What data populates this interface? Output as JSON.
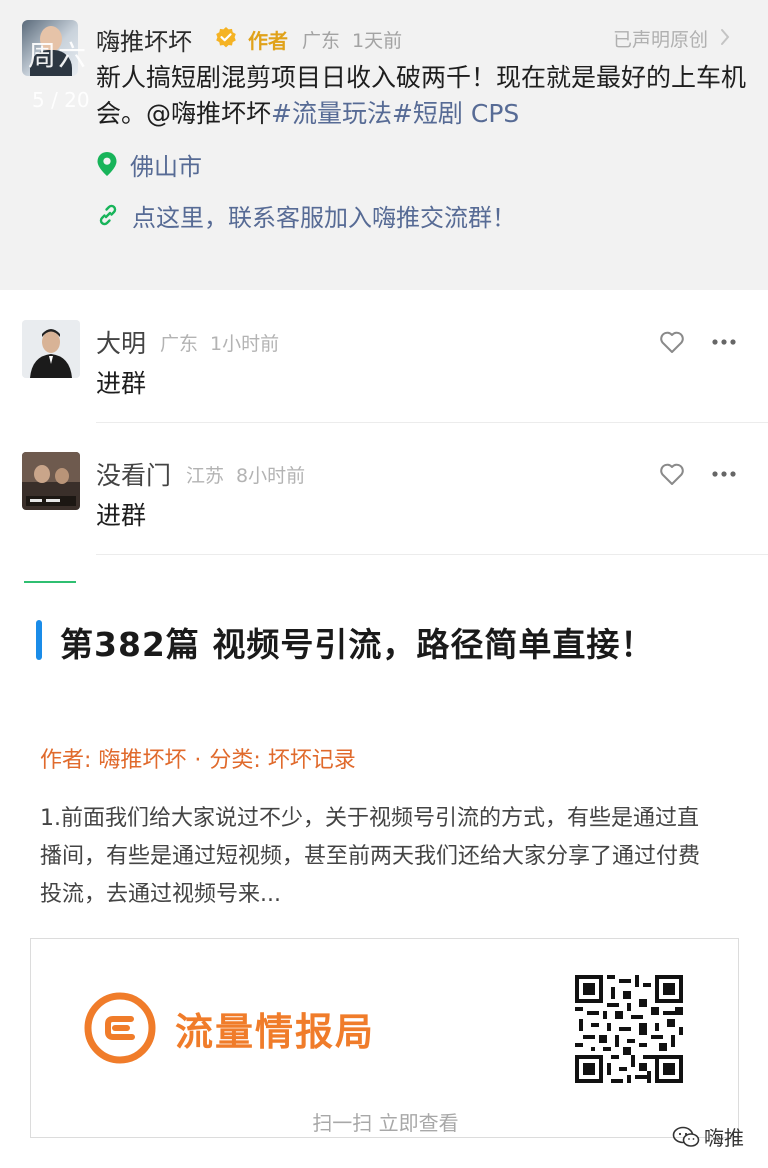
{
  "post": {
    "overlay_title": "周六",
    "overlay_sub": "5 / 20",
    "author_name": "嗨推坏坏",
    "author_tag": "作者",
    "location_short": "广东",
    "time_ago": "1天前",
    "original_label": "已声明原创",
    "text_prefix": "新人搞短剧混剪项目日收入破两千！现在就是最好的上车机会。@嗨推坏坏",
    "hashtag_1": "#流量玩法",
    "hashtag_2": "#短剧 CPS",
    "location_city": "佛山市",
    "link_text": "点这里，联系客服加入嗨推交流群！",
    "accent_color": "#576b95"
  },
  "comments": [
    {
      "name": "大明",
      "location": "广东",
      "time": "1小时前",
      "text": "进群"
    },
    {
      "name": "没看门",
      "location": "江苏",
      "time": "8小时前",
      "text": "进群"
    }
  ],
  "article": {
    "title": "第382篇   视频号引流，路径简单直接！",
    "author_label": "作者: 嗨推坏坏",
    "separator": "·",
    "category_label": "分类: 坏坏记录",
    "excerpt": "1.前面我们给大家说过不少，关于视频号引流的方式，有些是通过直播间，有些是通过短视频，甚至前两天我们还给大家分享了通过付费投流，去通过视频号来...",
    "meta_color": "#e06a2c",
    "title_bar_color": "#1a8ce8"
  },
  "qr_card": {
    "brand_name": "流量情报局",
    "scan_text": "扫一扫 立即查看",
    "brand_color": "#f07c2a"
  },
  "watermark": {
    "text": "嗨推"
  }
}
